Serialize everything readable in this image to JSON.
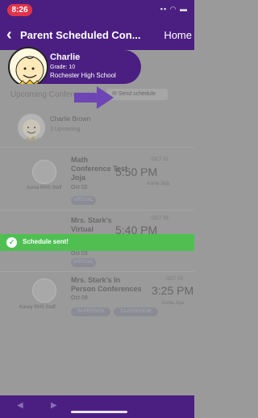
{
  "status_bar": {
    "time": "8:26",
    "icons": "▪▪ ◠ ▬"
  },
  "nav": {
    "back_icon": "back-chevron-icon",
    "title": "Parent Scheduled Con...",
    "home": "Home"
  },
  "student": {
    "name": "Charlie",
    "grade": "Grade: 10",
    "school": "Rochester High School"
  },
  "section": {
    "header": "Upcoming Conferences",
    "send_schedule": "Send schedule"
  },
  "teacher": {
    "name": "Charlie Brown",
    "upcoming": "3 Upcoming"
  },
  "conferences": [
    {
      "staff": "Asma RHS Staff",
      "title_line1": "Math",
      "title_line2": "Conference Test",
      "title_line3": "Joja",
      "date": "Oct 02",
      "month_day": "OCT 02",
      "time": "5:50 PM",
      "location": "Asma Joja",
      "tags": [
        "VIRTUAL"
      ]
    },
    {
      "staff": "",
      "title_line1": "Mrs. Stark's",
      "title_line2": "Virtual",
      "title_line3": "",
      "date": "Oct 03",
      "month_day": "OCT 03",
      "time": "5:40 PM",
      "location": "",
      "tags": [
        "VIRTUAL"
      ]
    },
    {
      "staff": "Kasey RHS Staff",
      "title_line1": "Mrs. Stark's In",
      "title_line2": "Person Conferences",
      "title_line3": "",
      "date": "Oct 09",
      "month_day": "OCT 09",
      "time": "3:25 PM",
      "location": "Asma Joja",
      "tags": [
        "IN-PERSON",
        "CLASSROOM"
      ]
    }
  ],
  "toast": {
    "text": "Schedule sent!",
    "icon": "check-circle-icon"
  },
  "bottom_nav": {
    "prev_icon": "back-arrow-icon",
    "next_icon": "forward-arrow-icon"
  },
  "colors": {
    "brand_purple": "#4b1f82",
    "toast_green": "#4fbf52",
    "time_pill_red": "#e3324a",
    "dim_overlay": "#9a9a9a"
  }
}
